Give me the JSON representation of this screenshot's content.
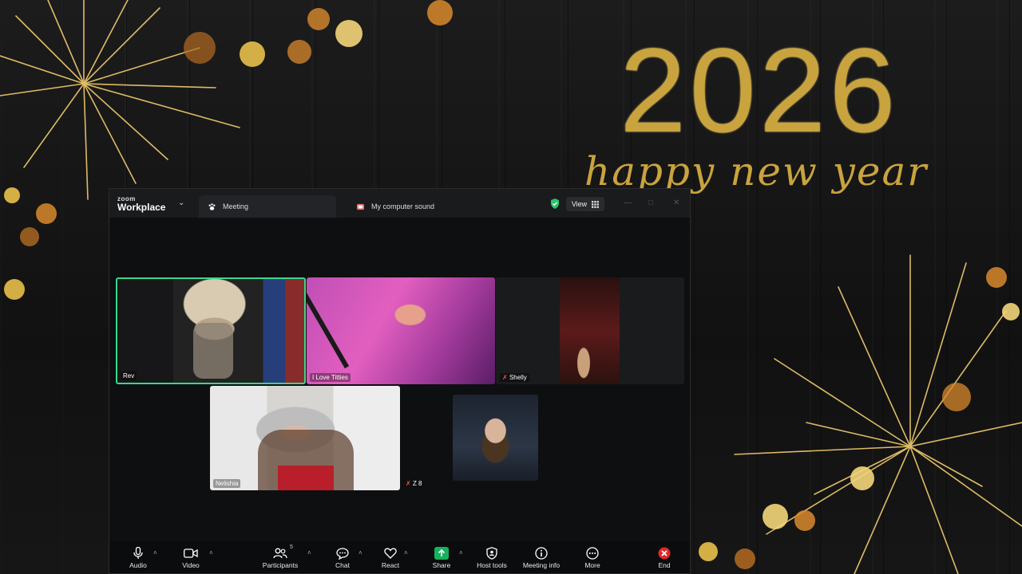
{
  "wallpaper": {
    "year": "2026",
    "greeting": "happy new year"
  },
  "window": {
    "logo_top": "zoom",
    "logo_bottom": "Workplace",
    "tabs": [
      {
        "label": "Meeting",
        "icon": "paw-icon",
        "active": true
      },
      {
        "label": "My computer sound",
        "icon": "speaker-icon",
        "active": false
      }
    ],
    "view_label": "View"
  },
  "participants": [
    {
      "name": "Rev",
      "speaking": true,
      "muted": false
    },
    {
      "name": "I Love Titties",
      "speaking": false,
      "muted": false
    },
    {
      "name": "Shelly",
      "speaking": false,
      "muted": true
    },
    {
      "name": "Nelishia",
      "speaking": false,
      "muted": false
    },
    {
      "name": "Z 8",
      "speaking": false,
      "muted": true
    },
    {
      "name": "",
      "speaking": false,
      "muted": false
    }
  ],
  "toolbar": {
    "audio": "Audio",
    "video": "Video",
    "participants": "Participants",
    "participants_count": "5",
    "chat": "Chat",
    "react": "React",
    "share": "Share",
    "host_tools": "Host tools",
    "meeting_info": "Meeting info",
    "more": "More",
    "end": "End"
  },
  "colors": {
    "accent_gold": "#c9a33e",
    "speaking_border": "#3ad88a",
    "share_green": "#17b15b",
    "end_red": "#e02828"
  }
}
